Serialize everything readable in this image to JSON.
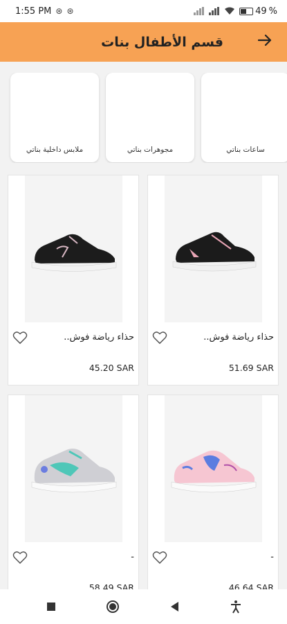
{
  "status": {
    "time": "1:55 PM",
    "battery": "49"
  },
  "header": {
    "title": "قسم الأطفال بنات"
  },
  "categories": [
    {
      "label": "ساعات بناتي"
    },
    {
      "label": "مجوهرات بناتي"
    },
    {
      "label": "ملابس داخلية بناتي"
    }
  ],
  "products": [
    {
      "title": "حذاء رياضة فوش..",
      "price": "51.69 SAR",
      "shoe_colors": {
        "body": "#1b1b1b",
        "accent": "#e8a5b5",
        "sole": "#f0f0f0"
      }
    },
    {
      "title": "حذاء رياضة فوش..",
      "price": "45.20 SAR",
      "shoe_colors": {
        "body": "#1c1c1c",
        "accent": "#d9b8c4",
        "sole": "#f2f2f2"
      }
    },
    {
      "title": "-",
      "price": "46.64 SAR",
      "shoe_colors": {
        "body": "#f6c6d2",
        "accent": "#5b7de0",
        "sole": "#fafafa"
      }
    },
    {
      "title": "-",
      "price": "58.49 SAR",
      "shoe_colors": {
        "body": "#cfcfd4",
        "accent": "#4fc7b8",
        "sole": "#fafafa"
      }
    }
  ],
  "icons": {
    "back": "arrow-right-icon",
    "favorite": "heart-outline-icon",
    "nav": [
      "stop-square-icon",
      "home-circle-icon",
      "back-triangle-icon",
      "accessibility-icon"
    ]
  }
}
